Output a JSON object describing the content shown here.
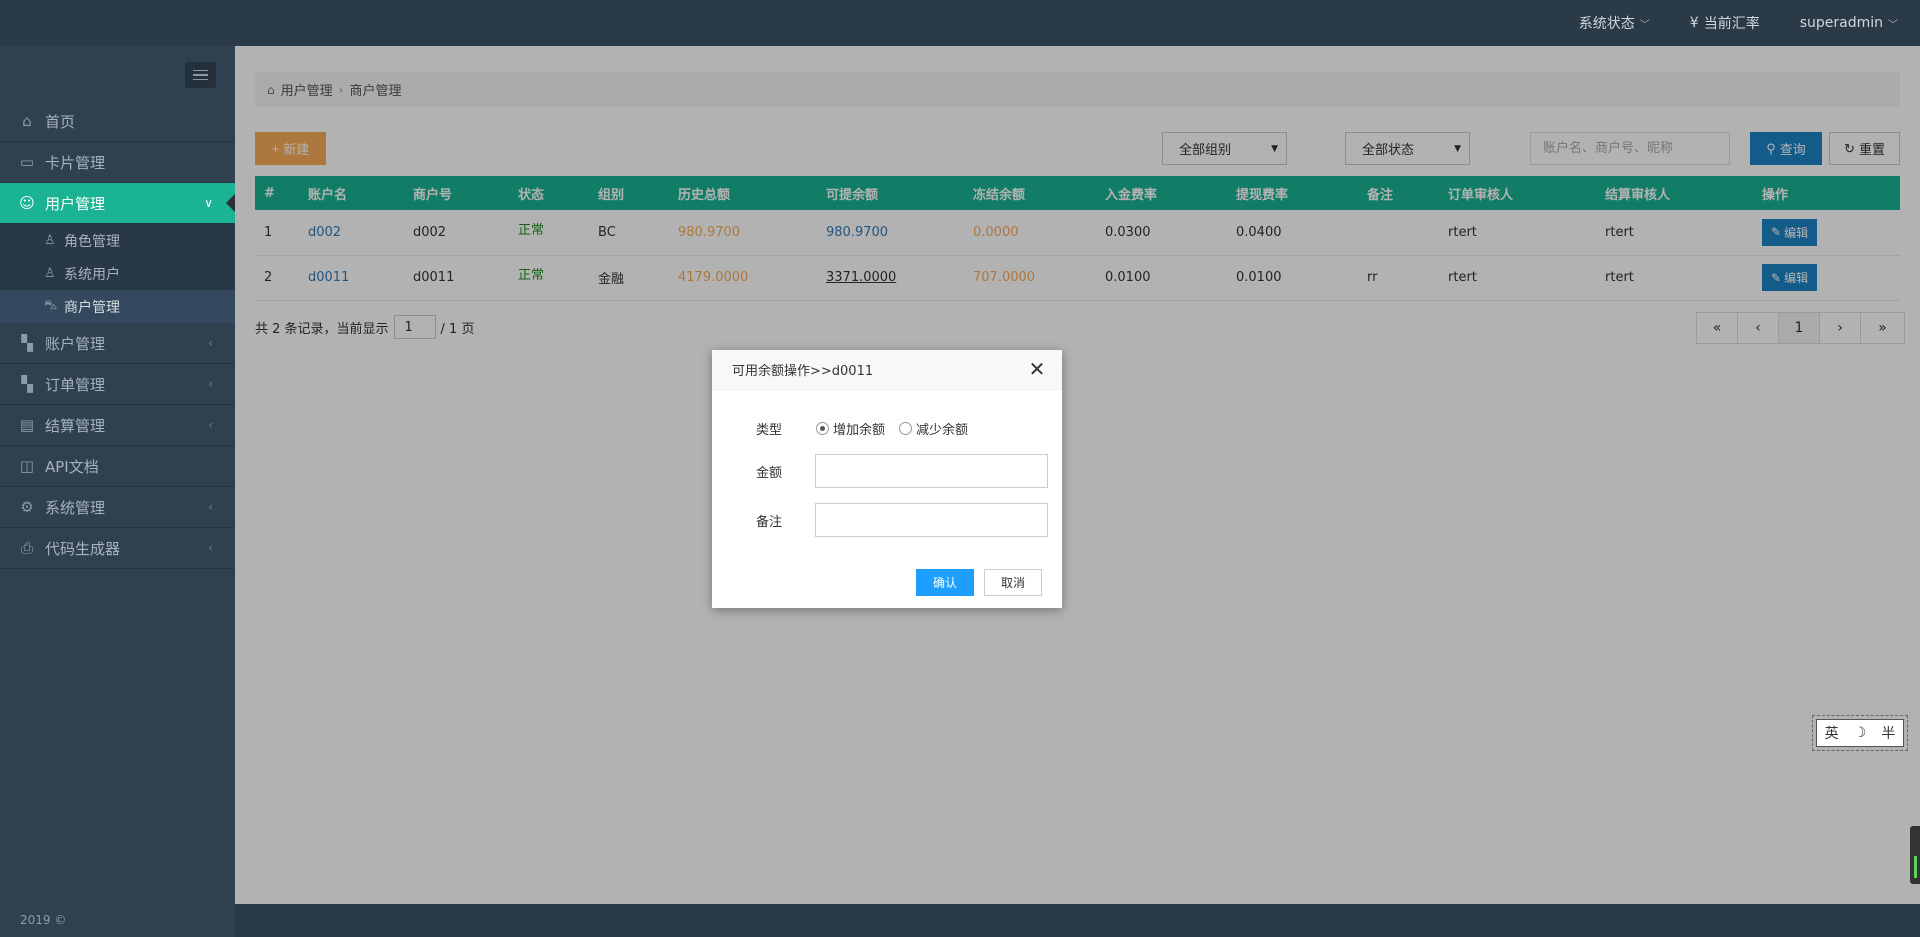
{
  "topbar": {
    "system_status": "系统状态",
    "exchange_rate": "当前汇率",
    "user": "superadmin"
  },
  "sidebar": {
    "items": [
      {
        "label": "首页",
        "icon": "home-icon"
      },
      {
        "label": "卡片管理",
        "icon": "card-icon"
      },
      {
        "label": "用户管理",
        "icon": "users-icon"
      },
      {
        "label": "账户管理",
        "icon": "cube-icon"
      },
      {
        "label": "订单管理",
        "icon": "cube-icon"
      },
      {
        "label": "结算管理",
        "icon": "file-icon"
      },
      {
        "label": "API文档",
        "icon": "book-icon"
      },
      {
        "label": "系统管理",
        "icon": "gear-icon"
      },
      {
        "label": "代码生成器",
        "icon": "print-icon"
      }
    ],
    "sub_items": [
      {
        "label": "角色管理",
        "icon": "user-icon"
      },
      {
        "label": "系统用户",
        "icon": "user-icon"
      },
      {
        "label": "商户管理",
        "icon": "car-icon"
      }
    ],
    "footer": "2019 ©"
  },
  "breadcrumb": {
    "parent": "用户管理",
    "current": "商户管理"
  },
  "toolbar": {
    "new_label": "新建",
    "group_select": "全部组别",
    "status_select": "全部状态",
    "search_placeholder": "账户名、商户号、昵称",
    "query_label": "查询",
    "reset_label": "重置"
  },
  "table": {
    "headers": [
      "#",
      "账户名",
      "商户号",
      "状态",
      "组别",
      "历史总额",
      "可提余额",
      "冻结余额",
      "入金费率",
      "提现费率",
      "备注",
      "订单审核人",
      "结算审核人",
      "操作"
    ],
    "rows": [
      {
        "num": "1",
        "account": "d002",
        "merchant": "d002",
        "status": "正常",
        "group": "BC",
        "total": "980.9700",
        "available": "980.9700",
        "frozen": "0.0000",
        "deposit_rate": "0.0300",
        "withdraw_rate": "0.0400",
        "remark": "",
        "order_reviewer": "rtert",
        "settle_reviewer": "rtert",
        "action": "编辑"
      },
      {
        "num": "2",
        "account": "d0011",
        "merchant": "d0011",
        "status": "正常",
        "group": "金融",
        "total": "4179.0000",
        "available": "3371.0000",
        "frozen": "707.0000",
        "deposit_rate": "0.0100",
        "withdraw_rate": "0.0100",
        "remark": "rr",
        "order_reviewer": "rtert",
        "settle_reviewer": "rtert",
        "action": "编辑"
      }
    ]
  },
  "summary": {
    "prefix": "共 2 条记录，当前显示",
    "page": "1",
    "suffix": "/ 1 页"
  },
  "pager": [
    "«",
    "‹",
    "1",
    "›",
    "»"
  ],
  "modal": {
    "title": "可用余额操作>>d0011",
    "type_label": "类型",
    "option_add": "增加余额",
    "option_sub": "减少余额",
    "amount_label": "金额",
    "remark_label": "备注",
    "amount_value": "",
    "remark_value": "",
    "ok_label": "确认",
    "cancel_label": "取消"
  },
  "ime": {
    "lang": "英",
    "moon": "☽",
    "mode": "半"
  },
  "colors": {
    "accent": "#1ab394",
    "primary": "#1c84c6",
    "warning": "#f8ac59",
    "sidebar": "#2f4050"
  }
}
